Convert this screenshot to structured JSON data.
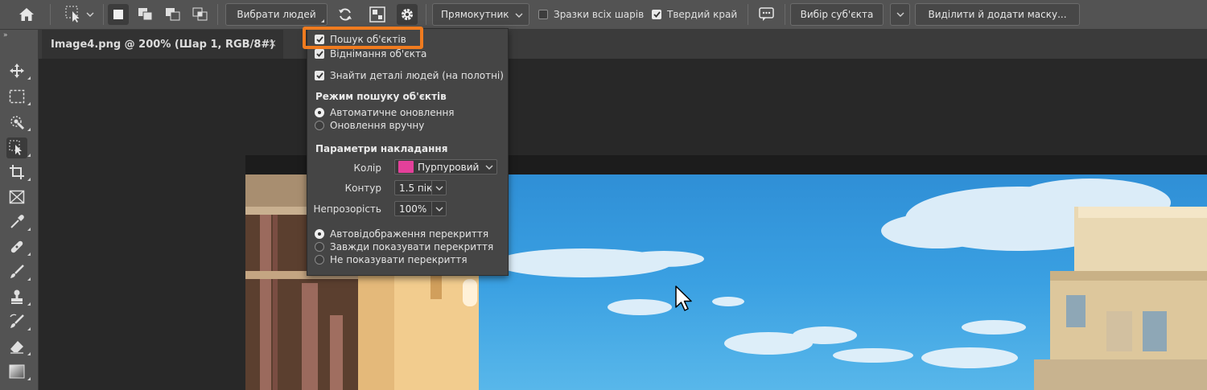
{
  "options_bar": {
    "select_people_label": "Вибрати людей",
    "mode_select": "Прямокутник",
    "sample_all_layers_label": "Зразки всіх шарів",
    "sample_all_layers_checked": false,
    "hard_edge_label": "Твердий край",
    "hard_edge_checked": true,
    "select_subject_label": "Вибір суб'єкта",
    "select_and_mask_label": "Виділити й додати маску..."
  },
  "tab": {
    "title": "Image4.png @ 200% (Шар 1, RGB/8#)",
    "close": "×"
  },
  "panel": {
    "object_finder_label": "Пошук об'єктів",
    "object_finder_checked": true,
    "object_subtraction_label": "Віднімання об'єкта",
    "object_subtraction_checked": true,
    "people_details_label": "Знайти деталі людей (на полотні)",
    "people_details_checked": true,
    "mode_title": "Режим пошуку об'єктів",
    "mode_auto": "Автоматичне оновлення",
    "mode_manual": "Оновлення вручну",
    "overlay_title": "Параметри накладання",
    "color_label": "Колір",
    "color_value": "Пурпуровий",
    "color_swatch": "#e4409a",
    "outline_label": "Контур",
    "outline_value": "1.5 пік",
    "opacity_label": "Непрозорість",
    "opacity_value": "100%",
    "overlay_auto": "Автовідображення перекриття",
    "overlay_always": "Завжди показувати перекриття",
    "overlay_never": "Не показувати перекриття"
  },
  "colors": {
    "highlight": "#ef7b1f",
    "sky": "#3aa0e2"
  },
  "tools": [
    "move-icon",
    "marquee-icon",
    "quick-selection-icon",
    "object-selection-icon",
    "crop-icon",
    "frame-icon",
    "eyedropper-icon",
    "healing-brush-icon",
    "brush-icon",
    "clone-stamp-icon",
    "history-brush-icon",
    "eraser-icon",
    "gradient-icon"
  ]
}
